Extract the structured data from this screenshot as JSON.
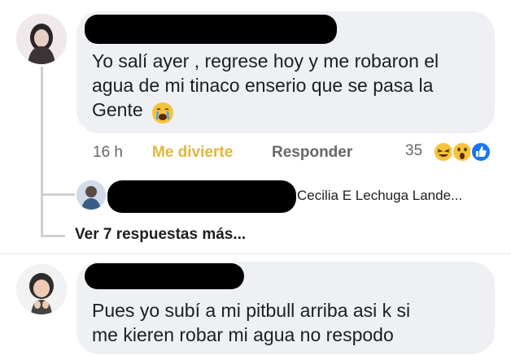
{
  "comment1": {
    "text": "Yo salí ayer , regrese hoy y me robaron el\nagua de mi tinaco enserio que se pasa la\nGente",
    "time": "16 h",
    "reaction_label": "Me divierte",
    "reply_label": "Responder",
    "reaction_count": "35",
    "reaction_icons": [
      "laughing-emoji-icon",
      "wow-emoji-icon",
      "like-icon"
    ],
    "inline_emoji": "crying-emoji-icon"
  },
  "reply_preview": {
    "name": "Cecilia E Lechuga Lande..."
  },
  "more_replies_label": "Ver 7 respuestas más...",
  "comment2": {
    "text": "Pues yo subí a mi pitbull arriba asi k si\nme kieren robar mi agua no respodo"
  },
  "colors": {
    "bubble": "#eef0f3",
    "reaction_active": "#e4b53d",
    "meta_gray": "#65676b",
    "like_blue": "#1877f2"
  }
}
